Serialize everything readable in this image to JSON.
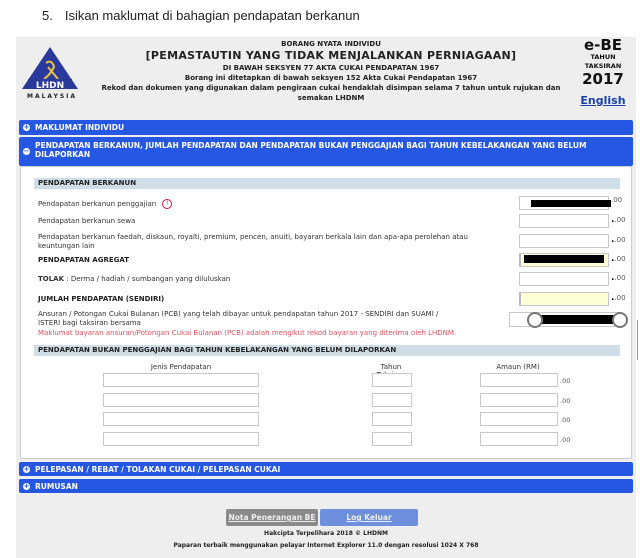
{
  "step": {
    "number": "5.",
    "text": "Isikan maklumat di bahagian pendapatan berkanun"
  },
  "header": {
    "logo_text": "LHDN",
    "logo_country": "MALAYSIA",
    "line1": "BORANG NYATA INDIVIDU",
    "line2": "[PEMASTAUTIN YANG TIDAK MENJALANKAN PERNIAGAAN]",
    "line3": "DI BAWAH SEKSYEN 77 AKTA CUKAI PENDAPATAN 1967",
    "line4": "Borang ini ditetapkan di bawah seksyen 152 Akta Cukai Pendapatan 1967",
    "line5": "Rekod dan dokumen yang digunakan dalam pengiraan cukai hendaklah disimpan selama 7 tahun untuk rujukan dan semakan LHDNM",
    "form_code": "e-BE",
    "year_label_1": "TAHUN",
    "year_label_2": "TAKSIRAN",
    "year": "2017",
    "language_link": "English"
  },
  "accordion": [
    {
      "label": "MAKLUMAT INDIVIDU",
      "icon": "plus-circle-icon",
      "expanded": false
    },
    {
      "label": "PENDAPATAN BERKANUN, JUMLAH PENDAPATAN DAN PENDAPATAN BUKAN PENGGAJIAN BAGI TAHUN KEBELAKANGAN YANG BELUM DILAPORKAN",
      "icon": "minus-circle-icon",
      "expanded": true
    },
    {
      "label": "PELEPASAN / REBAT / TOLAKAN CUKAI / PELEPASAN CUKAI",
      "icon": "plus-circle-icon",
      "expanded": false
    },
    {
      "label": "RUMUSAN",
      "icon": "plus-circle-icon",
      "expanded": false
    }
  ],
  "statutory": {
    "heading": "PENDAPATAN BERKANUN",
    "rows": [
      {
        "label": "Pendapatan berkanun penggajian",
        "value": "[redacted]",
        "cents": ".00",
        "info_icon": true
      },
      {
        "label": "Pendapatan berkanun sewa",
        "value": "",
        "cents": ".00"
      },
      {
        "label": "Pendapatan berkanun faedah, diskaun, royalti, premium, pencen, anuiti, bayaran berkala lain dan apa-apa perolehan atau keuntungan lain",
        "value": "",
        "cents": ".00"
      },
      {
        "label": "PENDAPATAN AGREGAT",
        "value": "[redacted]",
        "cents": ".00",
        "readonly": true
      },
      {
        "label_bold": "TOLAK",
        "label": " : Derma / hadiah / sumbangan yang diluluskan",
        "value": "",
        "cents": ".00"
      },
      {
        "label": "JUMLAH PENDAPATAN (SENDIRI)",
        "value": "",
        "cents": ".00",
        "readonly": true
      },
      {
        "label": "Ansuran / Potongan Cukai Bulanan (PCB) yang telah dibayar untuk pendapatan tahun 2017 - SENDIRI dan SUAMI / ISTERI bagi taksiran bersama",
        "value": "[redacted]"
      }
    ],
    "pcb_note": "Maklumat bayaran ansuran/Potongan Cukai Bulanan (PCB) adalah mengikut rekod bayaran yang diterima oleh LHDNM."
  },
  "non_employment": {
    "heading": "PENDAPATAN BUKAN PENGGAJIAN BAGI TAHUN KEBELAKANGAN YANG BELUM DILAPORKAN",
    "columns": [
      "Jenis Pendapatan",
      "Tahun Taksiran",
      "Amaun (RM)"
    ],
    "rows": [
      {
        "jenis": "",
        "tahun": "",
        "amaun": "",
        "cents": ".00"
      },
      {
        "jenis": "",
        "tahun": "",
        "amaun": "",
        "cents": ".00"
      },
      {
        "jenis": "",
        "tahun": "",
        "amaun": "",
        "cents": ".00"
      },
      {
        "jenis": "",
        "tahun": "",
        "amaun": "",
        "cents": ".00"
      }
    ]
  },
  "buttons": {
    "help": "Nota Penerangan BE",
    "logout": "Log Keluar"
  },
  "footer": {
    "copyright": "Hakcipta Terpelihara 2018 © LHDNM",
    "browser_note": "Paparan terbaik menggunakan pelayar Internet Explorer 11.0 dengan resolusi 1024 X 768"
  },
  "colors": {
    "accordion": "#2557e3",
    "section_header": "#cfdde6",
    "note_red": "#e05060",
    "readonly_field": "#ffffd6"
  }
}
